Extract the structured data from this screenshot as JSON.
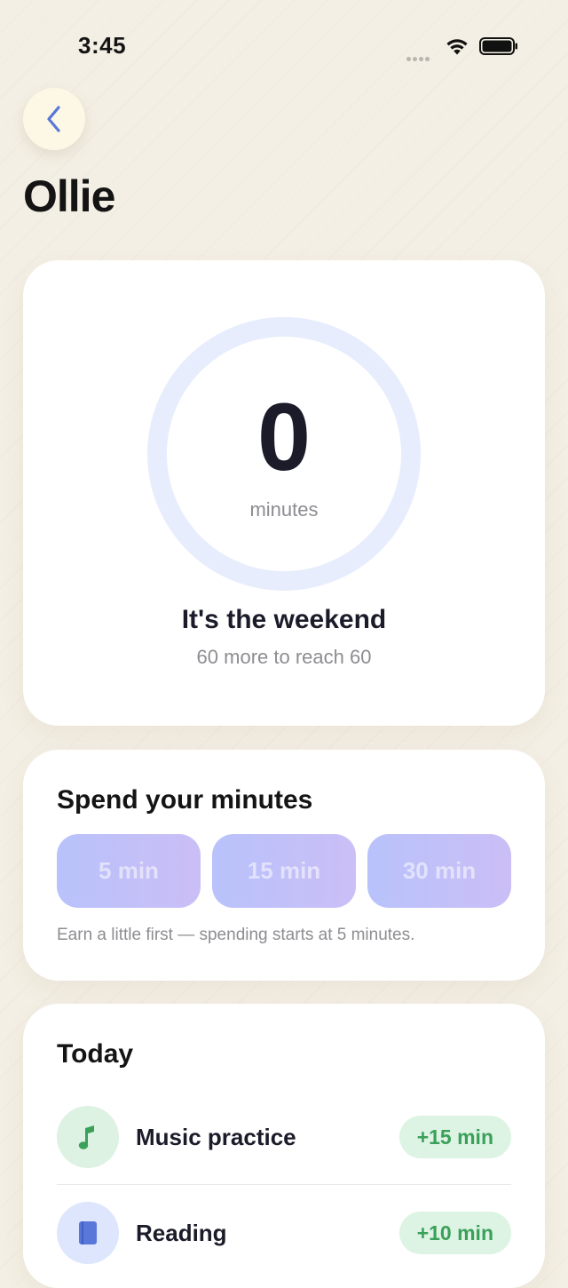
{
  "status_bar": {
    "time": "3:45"
  },
  "header": {
    "title": "Ollie",
    "back_icon": "chevron-left-icon"
  },
  "summary": {
    "minutes": "0",
    "unit": "minutes",
    "progress": 0,
    "headline": "It's the weekend",
    "subtext": "60 more to reach 60"
  },
  "spend": {
    "heading": "Spend your minutes",
    "options": [
      "5 min",
      "15 min",
      "30 min"
    ],
    "hint": "Earn a little first — spending starts at 5 minutes."
  },
  "today": {
    "heading": "Today",
    "items": [
      {
        "label": "Music practice",
        "reward": "+15 min",
        "icon": "music-note-icon"
      },
      {
        "label": "Reading",
        "reward": "+10 min",
        "icon": "book-icon"
      }
    ]
  },
  "colors": {
    "background": "#f4efe4",
    "ring_track": "#e7edfc",
    "accent_blue": "#5877d8",
    "reward_green": "#3ba05a",
    "chip_gradient": [
      "#b3bdfb",
      "#c7b9f6"
    ]
  }
}
